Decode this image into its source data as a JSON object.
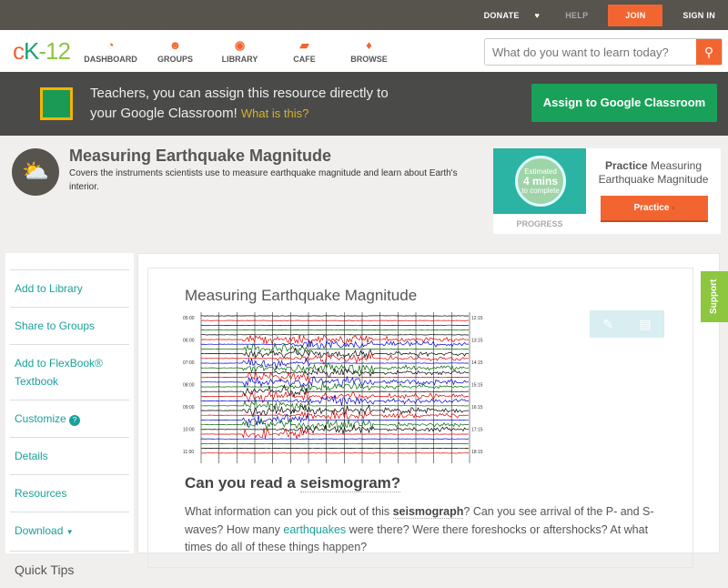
{
  "topbar": {
    "donate": "DONATE",
    "help": "HELP",
    "join": "JOIN",
    "signin": "SIGN IN"
  },
  "nav": {
    "logo": "cK-12",
    "items": [
      {
        "label": "DASHBOARD",
        "icon": "dashboard-icon"
      },
      {
        "label": "GROUPS",
        "icon": "groups-icon"
      },
      {
        "label": "LIBRARY",
        "icon": "library-icon"
      },
      {
        "label": "CAFE",
        "icon": "cafe-icon"
      },
      {
        "label": "BROWSE",
        "icon": "browse-icon"
      }
    ],
    "search_placeholder": "What do you want to learn today?"
  },
  "classroom": {
    "text1": "Teachers, you can assign this resource directly to",
    "text2": "your Google Classroom!",
    "whatis": "What is this?",
    "button": "Assign to Google Classroom"
  },
  "header": {
    "title": "Measuring Earthquake Magnitude",
    "description": "Covers the instruments scientists use to measure earthquake magnitude and learn about Earth's interior."
  },
  "practice": {
    "estimated": "Estimated",
    "mins": "4 mins",
    "complete": "to complete",
    "progress": "PROGRESS",
    "title_bold": "Practice",
    "title_rest": "Measuring Earthquake Magnitude",
    "button": "Practice"
  },
  "sidebar": {
    "items": [
      "Add to Library",
      "Share to Groups",
      "Add to FlexBook® Textbook",
      "Customize",
      "Details",
      "Resources",
      "Download"
    ],
    "quick_tips": "Quick Tips"
  },
  "content": {
    "title": "Measuring Earthquake Magnitude",
    "seismo_left": [
      "05:00",
      "06:00",
      "07:00",
      "08:00",
      "09:00",
      "10:00",
      "11:00"
    ],
    "seismo_right": [
      "12:15",
      "13:15",
      "14:15",
      "15:15",
      "16:15",
      "17:15",
      "18:15"
    ],
    "heading_pre": "Can you read a ",
    "heading_link": "seismogram?",
    "p_1": "What information can you pick out of this ",
    "p_link1": "seismograph",
    "p_2": "? Can you see arrival of the P- and S-waves? How many ",
    "p_link2": "earthquakes",
    "p_3": " were there? Were there foreshocks or aftershocks? At what times do all of these things happen?"
  },
  "support": "Support"
}
